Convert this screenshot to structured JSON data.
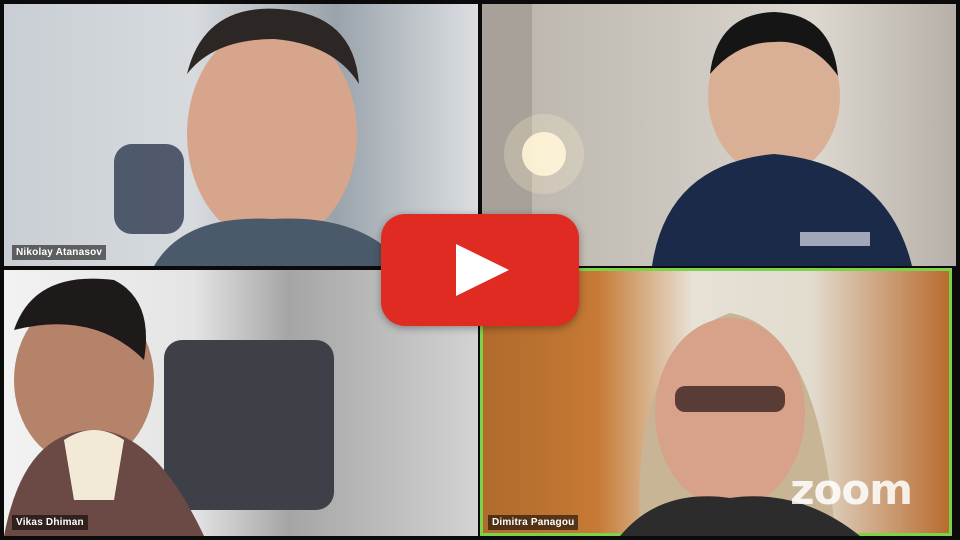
{
  "participants": [
    {
      "name": "Nikolay Atanasov",
      "active": false
    },
    {
      "name": "Vikas Dhiman",
      "active": false
    },
    {
      "name": "Dimitra Panagou",
      "active": true
    }
  ],
  "watermark": "zoom",
  "play_button": {
    "icon": "play-icon",
    "color": "#e02b22"
  },
  "colors": {
    "active_speaker_border": "#7cd34a"
  }
}
